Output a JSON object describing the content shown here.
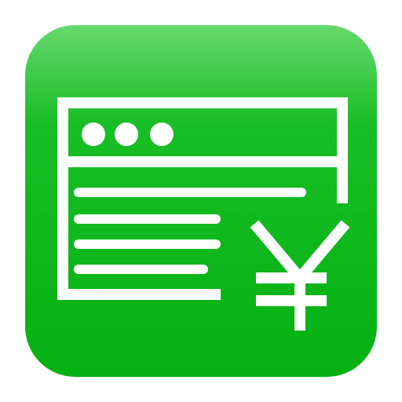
{
  "icon": {
    "semantic": "web-page-with-yen-icon",
    "symbol": "¥",
    "colors": {
      "background_top": "#67d86d",
      "background_mid": "#18be26",
      "background_bottom": "#04b112",
      "foreground": "#ffffff"
    }
  }
}
